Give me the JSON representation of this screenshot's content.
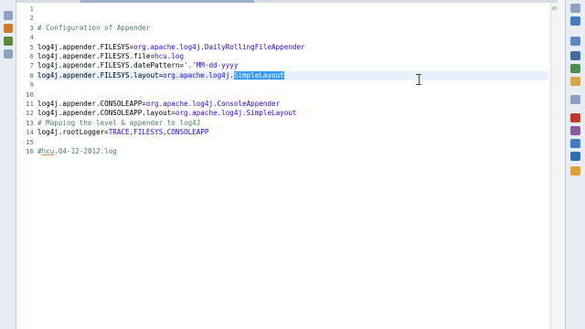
{
  "editor": {
    "line_numbers": [
      "1",
      "2",
      "3",
      "4",
      "5",
      "6",
      "7",
      "8",
      "9",
      "10",
      "11",
      "12",
      "13",
      "14",
      "15",
      "16"
    ],
    "lines": [
      [],
      [],
      [
        {
          "t": "# Configuration of Appender",
          "k": "comment"
        }
      ],
      [],
      [
        {
          "t": "log4j.appender.FILESYS=",
          "k": "plain"
        },
        {
          "t": "org.apache.log4j.DailyRollingFileAppender",
          "k": "value"
        }
      ],
      [
        {
          "t": "log4j.appender.FILESYS.file=",
          "k": "plain"
        },
        {
          "t": "hcu.log",
          "k": "value"
        }
      ],
      [
        {
          "t": "log4j.appender.FILESYS.datePattern=",
          "k": "plain"
        },
        {
          "t": "'.'MM-dd-yyyy",
          "k": "string"
        }
      ],
      [
        {
          "t": "log4j.appender.FILESYS.layout=",
          "k": "plain"
        },
        {
          "t": "org.apache.log4j.",
          "k": "value"
        },
        {
          "t": "SimpleLayout",
          "k": "selected"
        }
      ],
      [],
      [],
      [
        {
          "t": "log4j.appender.CONSOLEAPP=",
          "k": "plain"
        },
        {
          "t": "org.apache.log4j.ConsoleAppender",
          "k": "value"
        }
      ],
      [
        {
          "t": "log4j.appender.CONSOLEAPP.layout=",
          "k": "plain"
        },
        {
          "t": "org.apache.log4j.SimpleLayout",
          "k": "value"
        }
      ],
      [
        {
          "t": "# Mapping the level & appender to log4J",
          "k": "comment"
        }
      ],
      [
        {
          "t": "log4j.rootLogger=",
          "k": "plain"
        },
        {
          "t": "TRACE,FILESYS,CONSOLEAPP",
          "k": "value"
        }
      ],
      [],
      [
        {
          "t": "#",
          "k": "comment"
        },
        {
          "t": "hcu",
          "k": "comment-under"
        },
        {
          "t": ".04-12-2012.log",
          "k": "comment"
        }
      ]
    ],
    "current_line": 8
  },
  "colors": {
    "comment": "#4a8060",
    "value": "#2a00ff",
    "selection": "#3399ff",
    "current_line": "#e8f2fe"
  },
  "toolbar_left": [
    {
      "icon": "collapse-icon",
      "color": "#8da1c4"
    },
    {
      "icon": "hierarchy-icon",
      "color": "#d07a2e"
    },
    {
      "icon": "undo-icon",
      "color": "#5b8a3a"
    },
    {
      "icon": "task-icon",
      "color": "#8da1c4"
    }
  ],
  "toolbar_right": [
    {
      "icon": "maximize-icon",
      "color": "#8da1c4"
    },
    {
      "icon": "outline-icon",
      "color": "#3f7fbf"
    },
    {
      "icon": "list-icon",
      "color": "#5a8ac2"
    },
    {
      "icon": "console-icon",
      "color": "#3a6ea5"
    },
    {
      "icon": "tasks-icon",
      "color": "#4a8f4a"
    },
    {
      "icon": "note-icon",
      "color": "#d9a640"
    },
    {
      "icon": "minimize-icon",
      "color": "#8da1c4"
    },
    {
      "icon": "error-icon",
      "color": "#c0392b"
    },
    {
      "icon": "search-icon",
      "color": "#8a5aa0"
    },
    {
      "icon": "history-icon",
      "color": "#3f7fbf"
    },
    {
      "icon": "progress-icon",
      "color": "#2f6fb5"
    },
    {
      "icon": "debug-icon",
      "color": "#e0a030"
    }
  ]
}
